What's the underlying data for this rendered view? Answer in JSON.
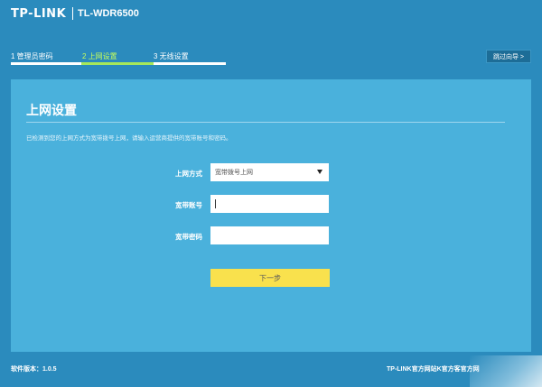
{
  "header": {
    "brand": "TP-LINK",
    "model": "TL-WDR6500"
  },
  "steps": [
    {
      "label": "1 管理员密码",
      "active": false
    },
    {
      "label": "2 上网设置",
      "active": true
    },
    {
      "label": "3 无线设置",
      "active": false
    }
  ],
  "skip_button": "跳过向导 >",
  "panel": {
    "title": "上网设置",
    "description": "已检测到您的上网方式为宽带拨号上网，请输入运营商提供的宽带账号和密码。",
    "connection_type_label": "上网方式",
    "connection_type_value": "宽带拨号上网",
    "account_label": "宽带账号",
    "account_value": "",
    "password_label": "宽带密码",
    "password_value": "",
    "next_button": "下一步"
  },
  "footer": {
    "version": "软件版本：1.0.5",
    "links": "TP-LINK官方网站K官方客官方网"
  },
  "colors": {
    "background": "#2b8bbd",
    "panel": "#4ab1dc",
    "active_step": "#a6e85a",
    "next_button": "#f9e14d"
  }
}
